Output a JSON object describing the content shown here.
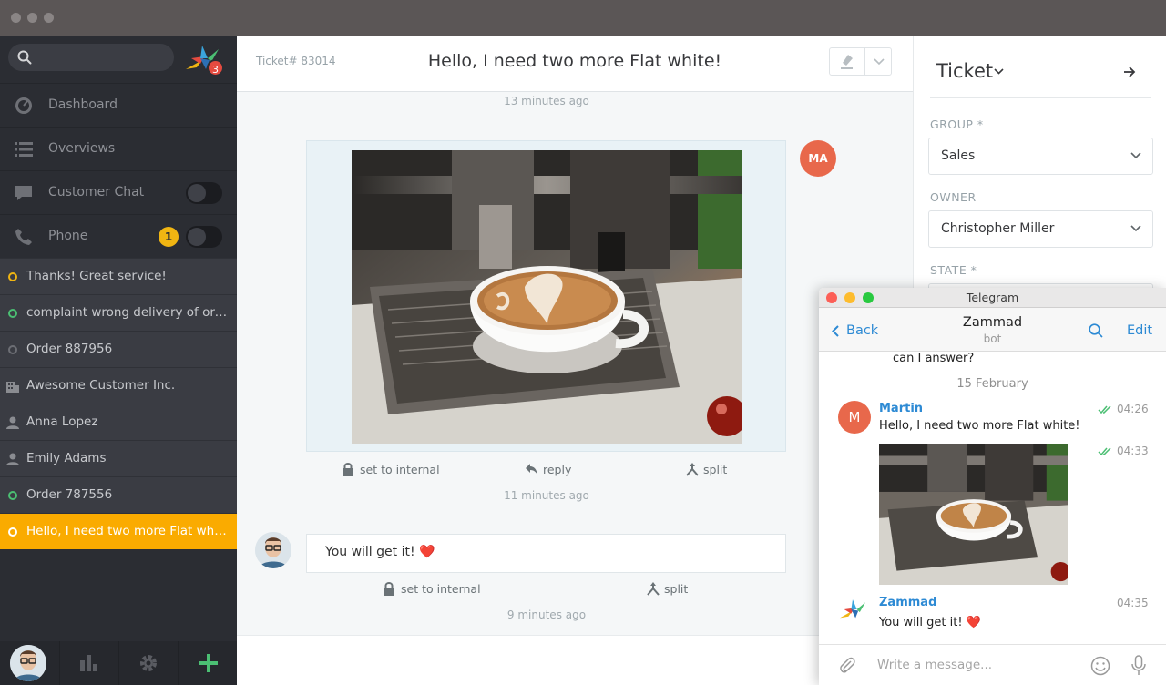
{
  "sidebar": {
    "search": {
      "placeholder": ""
    },
    "logo_badge": "3",
    "nav": [
      {
        "label": "Dashboard",
        "icon": "dashboard-icon"
      },
      {
        "label": "Overviews",
        "icon": "list-icon"
      },
      {
        "label": "Customer Chat",
        "icon": "chat-icon"
      },
      {
        "label": "Phone",
        "icon": "phone-icon",
        "badge": "1"
      }
    ],
    "tasks": [
      {
        "label": "Thanks! Great service!",
        "icon": "ticket-open-icon"
      },
      {
        "label": "complaint wrong delivery of ord…",
        "icon": "ticket-new-icon"
      },
      {
        "label": "Order 887956",
        "icon": "ticket-closed-icon"
      },
      {
        "label": "Awesome Customer Inc.",
        "icon": "organization-icon"
      },
      {
        "label": "Anna Lopez",
        "icon": "user-icon"
      },
      {
        "label": "Emily Adams",
        "icon": "user-icon"
      },
      {
        "label": "Order 787556",
        "icon": "ticket-new-icon"
      },
      {
        "label": "Hello, I need two more Flat white!",
        "icon": "ticket-open-icon"
      }
    ]
  },
  "ticket": {
    "number": "Ticket# 83014",
    "title": "Hello, I need two more Flat white!",
    "timestamps": [
      "13 minutes ago",
      "11 minutes ago",
      "9 minutes ago"
    ],
    "article1": {
      "avatar_initials": "MA",
      "actions": [
        "set to internal",
        "reply",
        "split"
      ]
    },
    "article2": {
      "text": "You will get it! ❤️",
      "actions": [
        "set to internal",
        "split"
      ]
    }
  },
  "right_panel": {
    "title": "Ticket",
    "group_label": "GROUP *",
    "group_value": "Sales",
    "owner_label": "OWNER",
    "owner_value": "Christopher Miller",
    "state_label": "STATE *"
  },
  "telegram": {
    "window_title": "Telegram",
    "back": "Back",
    "chat_name": "Zammad",
    "chat_sub": "bot",
    "edit": "Edit",
    "partial_text": "can I answer?",
    "date": "15 February",
    "msg1": {
      "sender": "Martin",
      "avatar": "M",
      "text": "Hello, I need two more Flat white!",
      "time": "04:26"
    },
    "photo_time": "04:33",
    "msg2": {
      "sender": "Zammad",
      "text": "You will get it! ❤️",
      "time": "04:35"
    },
    "input_placeholder": "Write a message..."
  },
  "colors": {
    "accent": "#faab00",
    "telegram_blue": "#2d8ad4",
    "avatar_red": "#e8684b"
  }
}
